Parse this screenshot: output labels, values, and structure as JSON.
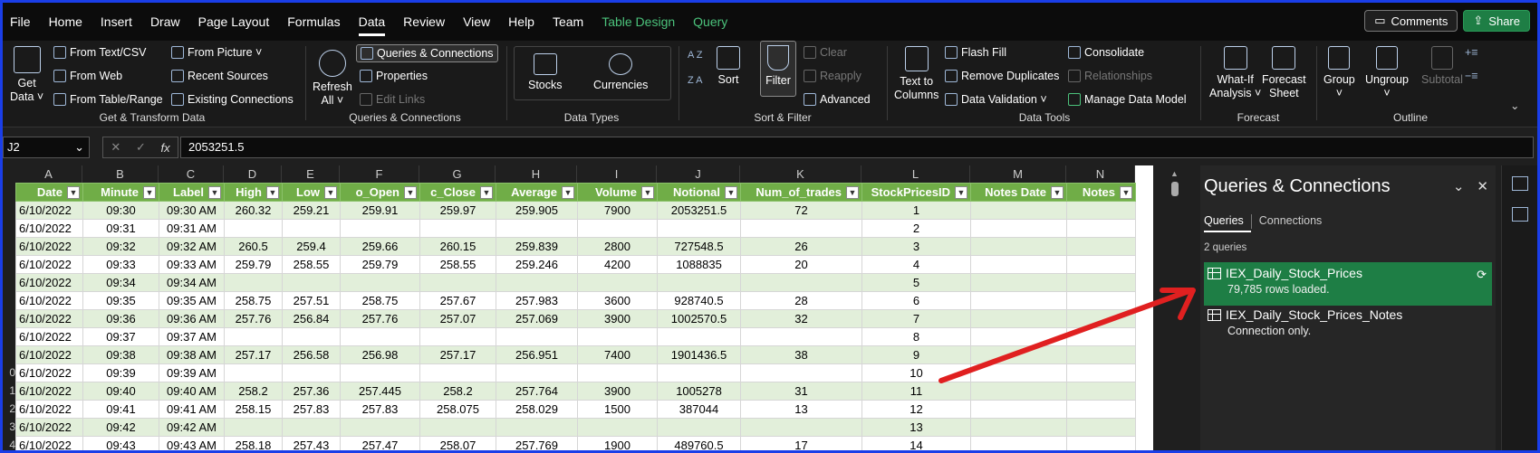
{
  "menu": {
    "items": [
      "File",
      "Home",
      "Insert",
      "Draw",
      "Page Layout",
      "Formulas",
      "Data",
      "Review",
      "View",
      "Help",
      "Team",
      "Table Design",
      "Query"
    ],
    "active": "Data",
    "comments_label": "Comments",
    "share_label": "Share"
  },
  "ribbon": {
    "get_data": {
      "label1": "Get",
      "label2": "Data ˅"
    },
    "from_text_csv": "From Text/CSV",
    "from_web": "From Web",
    "from_table_range": "From Table/Range",
    "from_picture": "From Picture ˅",
    "recent_sources": "Recent Sources",
    "existing_connections": "Existing Connections",
    "group_get_transform": "Get & Transform Data",
    "refresh_all": {
      "label1": "Refresh",
      "label2": "All ˅"
    },
    "queries_connections_btn": "Queries & Connections",
    "properties": "Properties",
    "edit_links": "Edit Links",
    "group_queries": "Queries & Connections",
    "stocks": "Stocks",
    "currencies": "Currencies",
    "group_data_types": "Data Types",
    "sort_az": "A Z",
    "sort": "Sort",
    "filter": "Filter",
    "clear": "Clear",
    "reapply": "Reapply",
    "advanced": "Advanced",
    "group_sort_filter": "Sort & Filter",
    "text_to_columns": {
      "label1": "Text to",
      "label2": "Columns"
    },
    "flash_fill": "Flash Fill",
    "remove_duplicates": "Remove Duplicates",
    "data_validation": "Data Validation  ˅",
    "consolidate": "Consolidate",
    "relationships": "Relationships",
    "manage_data_model": "Manage Data Model",
    "group_data_tools": "Data Tools",
    "what_if": {
      "label1": "What-If",
      "label2": "Analysis ˅"
    },
    "forecast_sheet": {
      "label1": "Forecast",
      "label2": "Sheet"
    },
    "group_forecast": "Forecast",
    "group_btn": {
      "label1": "Group",
      "label2": "˅"
    },
    "ungroup_btn": {
      "label1": "Ungroup",
      "label2": "˅"
    },
    "subtotal": "Subtotal",
    "group_outline": "Outline"
  },
  "formula_bar": {
    "name_box": "J2",
    "formula": "2053251.5"
  },
  "columns": [
    "A",
    "B",
    "C",
    "D",
    "E",
    "F",
    "G",
    "H",
    "I",
    "J",
    "K",
    "L",
    "M",
    "N"
  ],
  "row_numbers": [
    "",
    "",
    "",
    "",
    "",
    "",
    "0",
    "1",
    "2",
    "3",
    "4",
    ""
  ],
  "table": {
    "headers": [
      "Date",
      "Minute",
      "Label",
      "High",
      "Low",
      "o_Open",
      "c_Close",
      "Average",
      "Volume",
      "Notional",
      "Num_of_trades",
      "StockPricesID",
      "Notes Date",
      "Notes"
    ],
    "rows": [
      [
        "6/10/2022",
        "09:30",
        "09:30 AM",
        "260.32",
        "259.21",
        "259.91",
        "259.97",
        "259.905",
        "7900",
        "2053251.5",
        "72",
        "1",
        "",
        ""
      ],
      [
        "6/10/2022",
        "09:31",
        "09:31 AM",
        "",
        "",
        "",
        "",
        "",
        "",
        "",
        "",
        "2",
        "",
        ""
      ],
      [
        "6/10/2022",
        "09:32",
        "09:32 AM",
        "260.5",
        "259.4",
        "259.66",
        "260.15",
        "259.839",
        "2800",
        "727548.5",
        "26",
        "3",
        "",
        ""
      ],
      [
        "6/10/2022",
        "09:33",
        "09:33 AM",
        "259.79",
        "258.55",
        "259.79",
        "258.55",
        "259.246",
        "4200",
        "1088835",
        "20",
        "4",
        "",
        ""
      ],
      [
        "6/10/2022",
        "09:34",
        "09:34 AM",
        "",
        "",
        "",
        "",
        "",
        "",
        "",
        "",
        "5",
        "",
        ""
      ],
      [
        "6/10/2022",
        "09:35",
        "09:35 AM",
        "258.75",
        "257.51",
        "258.75",
        "257.67",
        "257.983",
        "3600",
        "928740.5",
        "28",
        "6",
        "",
        ""
      ],
      [
        "6/10/2022",
        "09:36",
        "09:36 AM",
        "257.76",
        "256.84",
        "257.76",
        "257.07",
        "257.069",
        "3900",
        "1002570.5",
        "32",
        "7",
        "",
        ""
      ],
      [
        "6/10/2022",
        "09:37",
        "09:37 AM",
        "",
        "",
        "",
        "",
        "",
        "",
        "",
        "",
        "8",
        "",
        ""
      ],
      [
        "6/10/2022",
        "09:38",
        "09:38 AM",
        "257.17",
        "256.58",
        "256.98",
        "257.17",
        "256.951",
        "7400",
        "1901436.5",
        "38",
        "9",
        "",
        ""
      ],
      [
        "6/10/2022",
        "09:39",
        "09:39 AM",
        "",
        "",
        "",
        "",
        "",
        "",
        "",
        "",
        "10",
        "",
        ""
      ],
      [
        "6/10/2022",
        "09:40",
        "09:40 AM",
        "258.2",
        "257.36",
        "257.445",
        "258.2",
        "257.764",
        "3900",
        "1005278",
        "31",
        "11",
        "",
        ""
      ],
      [
        "6/10/2022",
        "09:41",
        "09:41 AM",
        "258.15",
        "257.83",
        "257.83",
        "258.075",
        "258.029",
        "1500",
        "387044",
        "13",
        "12",
        "",
        ""
      ],
      [
        "6/10/2022",
        "09:42",
        "09:42 AM",
        "",
        "",
        "",
        "",
        "",
        "",
        "",
        "",
        "13",
        "",
        ""
      ],
      [
        "6/10/2022",
        "09:43",
        "09:43 AM",
        "258.18",
        "257.43",
        "257.47",
        "258.07",
        "257.769",
        "1900",
        "489760.5",
        "17",
        "14",
        "",
        ""
      ]
    ]
  },
  "pane": {
    "title": "Queries & Connections",
    "tab_queries": "Queries",
    "tab_connections": "Connections",
    "count": "2 queries",
    "queries": [
      {
        "name": "IEX_Daily_Stock_Prices",
        "sub": "79,785 rows loaded."
      },
      {
        "name": "IEX_Daily_Stock_Prices_Notes",
        "sub": "Connection only."
      }
    ]
  },
  "colors": {
    "accent_green": "#1e7e45",
    "table_header": "#70ad47",
    "band": "#e2efda",
    "arrow": "#e02020",
    "frame": "#1a3ee8"
  }
}
